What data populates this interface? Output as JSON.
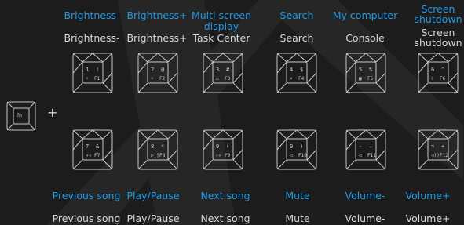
{
  "fn_key": {
    "label": "fn"
  },
  "plus_sign": "+",
  "top_row": [
    {
      "blue": [
        "Brightness-"
      ],
      "white": [
        "Brightness-"
      ],
      "num": "1",
      "sym": "!",
      "icon": "☼",
      "fkey": "F1"
    },
    {
      "blue": [
        "Brightness+"
      ],
      "white": [
        "Brightness+"
      ],
      "num": "2",
      "sym": "@",
      "icon": "☼",
      "fkey": "F2"
    },
    {
      "blue": [
        "Multi screen",
        "display"
      ],
      "white": [
        "Task Center"
      ],
      "num": "3",
      "sym": "#",
      "icon": "▭",
      "fkey": "F3"
    },
    {
      "blue": [
        "Search"
      ],
      "white": [
        "Search"
      ],
      "num": "4",
      "sym": "$",
      "icon": "⌕",
      "fkey": "F4"
    },
    {
      "blue": [
        "My computer"
      ],
      "white": [
        "Console"
      ],
      "num": "5",
      "sym": "%",
      "icon": "▦",
      "fkey": "F5"
    },
    {
      "blue": [
        "Screen",
        "shutdown"
      ],
      "white": [
        "Screen",
        "shutdown"
      ],
      "num": "6",
      "sym": "^",
      "icon": "☾",
      "fkey": "F6"
    }
  ],
  "bottom_row": [
    {
      "blue": "Previous song",
      "white": "Previous song",
      "num": "7",
      "sym": "&",
      "icon": "◃◃",
      "fkey": "F7"
    },
    {
      "blue": "Play/Pause",
      "white": "Play/Pause",
      "num": "8",
      "sym": "*",
      "icon": "▷||",
      "fkey": "F8"
    },
    {
      "blue": "Next song",
      "white": "Next song",
      "num": "9",
      "sym": "(",
      "icon": "▹▹",
      "fkey": "F9"
    },
    {
      "blue": "Mute",
      "white": "Mute",
      "num": "0",
      "sym": ")",
      "icon": "◁",
      "fkey": "F10"
    },
    {
      "blue": "Volume-",
      "white": "Volume-",
      "num": "-",
      "sym": "—",
      "icon": "◁",
      "fkey": "F11"
    },
    {
      "blue": "Volume+",
      "white": "Volume+",
      "num": "=",
      "sym": "+",
      "icon": "◁))",
      "fkey": "F12"
    }
  ],
  "colors": {
    "background": "#1c1c1c",
    "accent": "#1e9be6",
    "text": "#d8d8d8",
    "keycap_outline": "#c8c8c8"
  }
}
